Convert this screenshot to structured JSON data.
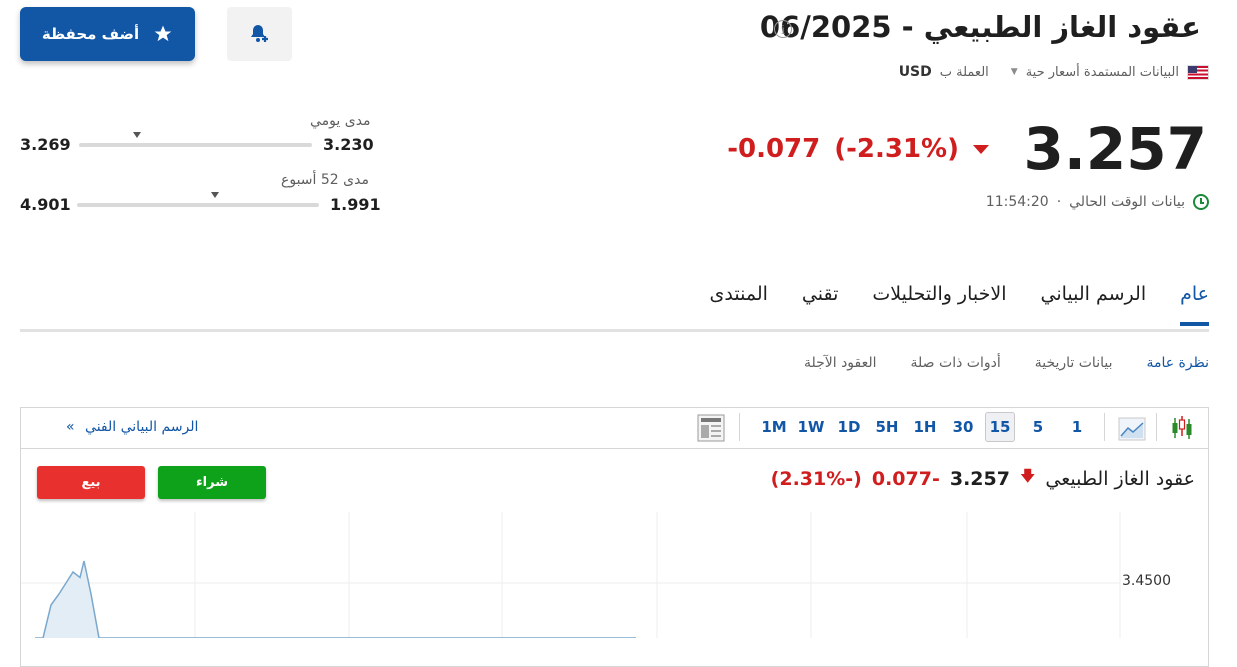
{
  "header": {
    "title": "عقود الغاز الطبيعي - 06/2025",
    "info_icon": "info-icon",
    "currency_prefix": "العملة ب",
    "currency": "USD",
    "data_source": "البيانات المستمدة أسعار حية",
    "add_portfolio_label": "أضف محفظة"
  },
  "quote": {
    "price": "3.257",
    "change": "-0.077",
    "change_pct": "(-2.31%)",
    "time": "11:54:20",
    "time_label": "بيانات الوقت الحالي"
  },
  "ranges": {
    "daily": {
      "label": "مدى يومي",
      "low": "3.230",
      "high": "3.269",
      "position": 0.25
    },
    "week52": {
      "label": "مدى 52 أسبوع",
      "low": "1.991",
      "high": "4.901",
      "position": 0.57
    }
  },
  "tabs": [
    {
      "label": "عام",
      "active": true
    },
    {
      "label": "الرسم البياني",
      "active": false
    },
    {
      "label": "الاخبار والتحليلات",
      "active": false
    },
    {
      "label": "تقني",
      "active": false
    },
    {
      "label": "المنتدى",
      "active": false
    }
  ],
  "subtabs": [
    {
      "label": "نظرة عامة",
      "active": true
    },
    {
      "label": "بيانات تاريخية",
      "active": false
    },
    {
      "label": "أدوات ذات صلة",
      "active": false
    },
    {
      "label": "العقود الآجلة",
      "active": false
    }
  ],
  "chart_toolbar": {
    "intervals": [
      "1",
      "5",
      "15",
      "30",
      "1H",
      "5H",
      "1D",
      "1W",
      "1M"
    ],
    "selected_interval": "15",
    "technical_chart_link": "الرسم البياني الفني"
  },
  "chart": {
    "title": "عقود الغاز الطبيعي",
    "price": "3.257",
    "change": "-0.077",
    "change_pct": "(-2.31%)",
    "buy_label": "شراء",
    "sell_label": "بيع",
    "colors": {
      "line": "#7aa7cc",
      "fill": "#e3edf6",
      "buy": "#0ea21b",
      "sell": "#e8312f",
      "down": "#d01e1e",
      "accent": "#1256a6"
    }
  },
  "chart_data": {
    "type": "area",
    "y_tick_labels": [
      "3.4500"
    ],
    "grid": true,
    "x": [
      0,
      1,
      2,
      3,
      4,
      5,
      6,
      7,
      8,
      9,
      10,
      11,
      12,
      13,
      14,
      15,
      16,
      17,
      18,
      19,
      20,
      21,
      22
    ],
    "values": [
      3.33,
      3.4,
      3.43,
      3.44,
      3.45,
      3.46,
      3.455,
      3.47,
      3.44,
      3.38,
      3.4,
      3.33,
      3.3,
      3.29,
      3.3,
      3.31,
      3.29,
      3.3,
      3.35,
      3.4,
      3.4,
      3.36,
      3.32
    ]
  }
}
